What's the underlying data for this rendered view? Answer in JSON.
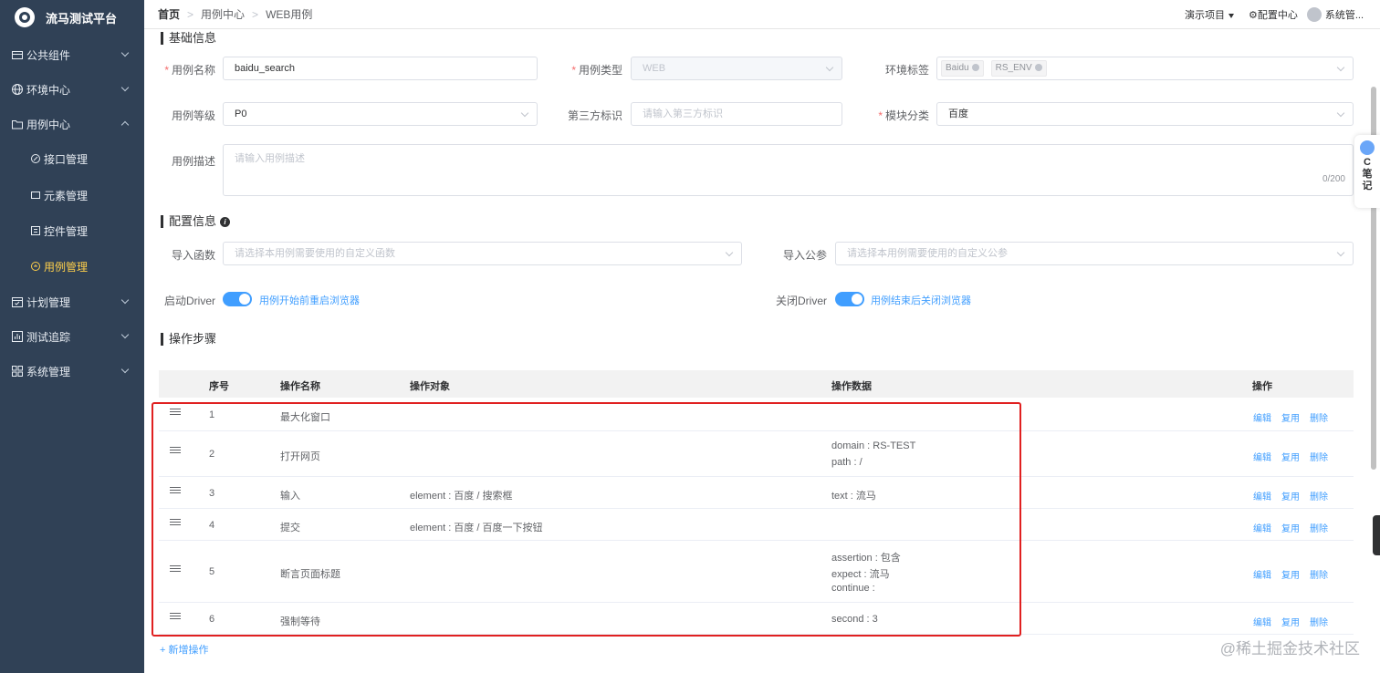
{
  "app": {
    "title": "流马测试平台"
  },
  "sidebar": {
    "items": [
      {
        "label": "公共组件",
        "icon": "package-icon"
      },
      {
        "label": "环境中心",
        "icon": "globe-icon"
      },
      {
        "label": "用例中心",
        "icon": "folder-icon"
      },
      {
        "label": "计划管理",
        "icon": "calendar-icon"
      },
      {
        "label": "测试追踪",
        "icon": "chart-icon"
      },
      {
        "label": "系统管理",
        "icon": "grid-icon"
      }
    ],
    "sub_items": [
      {
        "label": "接口管理",
        "icon": "link-icon"
      },
      {
        "label": "元素管理",
        "icon": "element-icon"
      },
      {
        "label": "控件管理",
        "icon": "widget-icon"
      },
      {
        "label": "用例管理",
        "icon": "case-icon"
      }
    ],
    "active_color": "#ffd04b",
    "bg_color": "#304156"
  },
  "header": {
    "breadcrumb": [
      "首页",
      "用例中心",
      "WEB用例"
    ],
    "project": "演示项目",
    "config": "配置中心",
    "user": "系统管..."
  },
  "basic": {
    "title": "基础信息",
    "name_label": "用例名称",
    "name_value": "baidu_search",
    "type_label": "用例类型",
    "type_value": "WEB",
    "env_label": "环境标签",
    "env_tags": [
      "Baidu",
      "RS_ENV"
    ],
    "level_label": "用例等级",
    "level_value": "P0",
    "third_label": "第三方标识",
    "third_placeholder": "请输入第三方标识",
    "module_label": "模块分类",
    "module_value": "百度",
    "desc_label": "用例描述",
    "desc_placeholder": "请输入用例描述",
    "desc_counter": "0/200"
  },
  "config": {
    "title": "配置信息",
    "func_label": "导入函数",
    "func_placeholder": "请选择本用例需要使用的自定义函数",
    "param_label": "导入公参",
    "param_placeholder": "请选择本用例需要使用的自定义公参",
    "start_label": "启动Driver",
    "start_text": "用例开始前重启浏览器",
    "close_label": "关闭Driver",
    "close_text": "用例结束后关闭浏览器"
  },
  "steps": {
    "title": "操作步骤",
    "columns": [
      "序号",
      "操作名称",
      "操作对象",
      "操作数据",
      "操作"
    ],
    "rows": [
      {
        "no": "1",
        "name": "最大化窗口",
        "target": "",
        "data": []
      },
      {
        "no": "2",
        "name": "打开网页",
        "target": "",
        "data": [
          "domain : RS-TEST",
          "path : /"
        ]
      },
      {
        "no": "3",
        "name": "输入",
        "target": "element : 百度 / 搜索框",
        "data": [
          "text : 流马"
        ]
      },
      {
        "no": "4",
        "name": "提交",
        "target": "element : 百度 / 百度一下按钮",
        "data": []
      },
      {
        "no": "5",
        "name": "断言页面标题",
        "target": "",
        "data": [
          "assertion : 包含",
          "expect : 流马",
          "continue :"
        ]
      },
      {
        "no": "6",
        "name": "强制等待",
        "target": "",
        "data": [
          "second : 3"
        ]
      }
    ],
    "actions": {
      "edit": "编辑",
      "copy": "复用",
      "delete": "删除"
    },
    "add_label": "+ 新增操作"
  },
  "note_widget": {
    "lines": [
      "C",
      "笔",
      "记"
    ]
  },
  "watermark": "@稀土掘金技术社区",
  "colors": {
    "primary": "#409eff",
    "required": "#f56c6c",
    "highlight": "#e02020"
  }
}
